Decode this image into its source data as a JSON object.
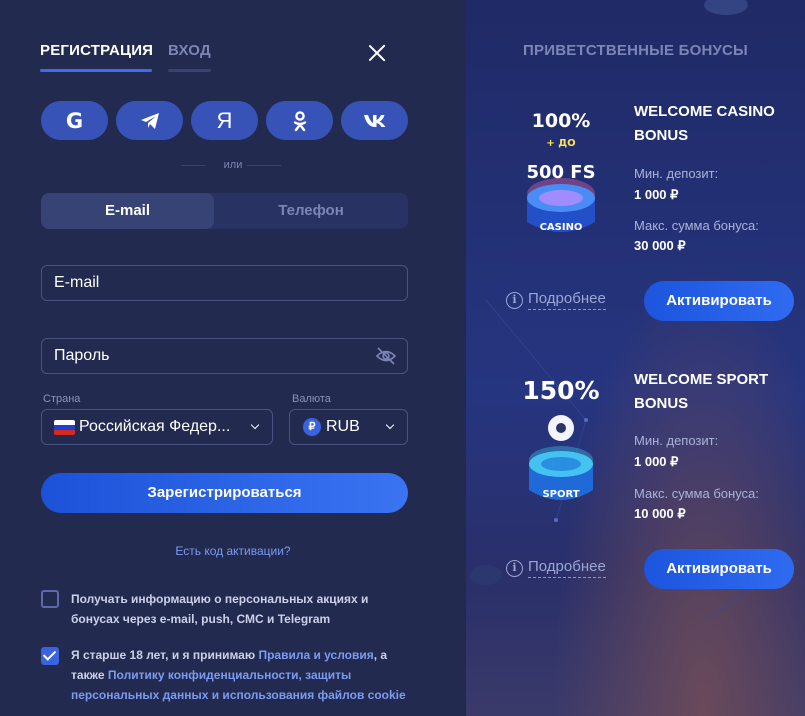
{
  "tabs": {
    "register": "РЕГИСТРАЦИЯ",
    "login": "ВХОД"
  },
  "social": {
    "google": "G",
    "yandex": "Я"
  },
  "divider_text": "или",
  "toggle": {
    "email": "E-mail",
    "phone": "Телефон"
  },
  "fields": {
    "email_placeholder": "E-mail",
    "password_placeholder": "Пароль",
    "country_label": "Страна",
    "country_value": "Российская Федер...",
    "currency_label": "Валюта",
    "currency_value": "RUB",
    "currency_symbol": "₽"
  },
  "register_button": "Зарегистрироваться",
  "promo_link": "Есть код активации?",
  "consents": {
    "marketing": "Получать информацию о персональных акциях и бонусах через e-mail, push, СМС и Telegram",
    "age_prefix": "Я старше 18 лет, и я принимаю ",
    "terms_link": "Правила и условия",
    "age_mid": ", а также ",
    "privacy_link": "Политику конфиденциальности, защиты персональных данных и использования файлов cookie",
    "marketing_checked": false,
    "age_checked": true
  },
  "bonuses": {
    "heading": "ПРИВЕТСТВЕННЫЕ БОНУСЫ",
    "casino": {
      "art_pct": "100%",
      "art_up_to": "+ ДО",
      "art_fs": "500 FS",
      "art_label": "CASINO",
      "title": "WELCOME CASINO BONUS",
      "min_label": "Мин. депозит:",
      "min_value": "1 000 ₽",
      "max_label": "Макс. сумма бонуса:",
      "max_value": "30 000 ₽",
      "more": "Подробнее",
      "activate": "Активировать"
    },
    "sport": {
      "art_pct": "150%",
      "art_label": "SPORT",
      "title": "WELCOME SPORT BONUS",
      "min_label": "Мин. депозит:",
      "min_value": "1 000 ₽",
      "max_label": "Макс. сумма бонуса:",
      "max_value": "10 000 ₽",
      "more": "Подробнее",
      "activate": "Активировать"
    }
  },
  "colors": {
    "accent": "#2f6bf0",
    "social_bg": "#3753b8",
    "panel": "#222a4f"
  }
}
